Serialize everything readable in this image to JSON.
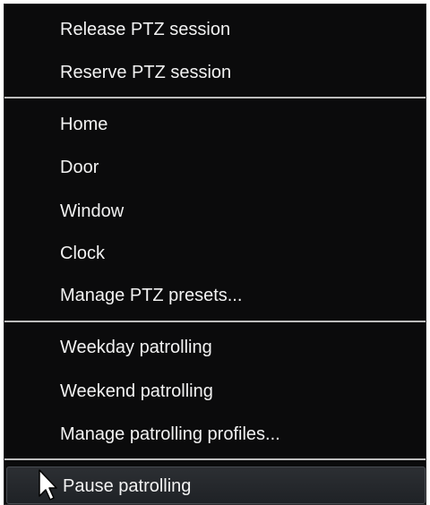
{
  "context_menu": {
    "session_group": [
      {
        "label": "Release PTZ session"
      },
      {
        "label": "Reserve PTZ session"
      }
    ],
    "preset_group": [
      {
        "label": "Home"
      },
      {
        "label": "Door"
      },
      {
        "label": "Window"
      },
      {
        "label": "Clock"
      },
      {
        "label": "Manage PTZ presets..."
      }
    ],
    "patrolling_group": [
      {
        "label": "Weekday patrolling"
      },
      {
        "label": "Weekend patrolling"
      },
      {
        "label": "Manage patrolling profiles..."
      }
    ],
    "pause_item": {
      "label": "Pause patrolling"
    },
    "cursor_icon": "arrow-pointer-icon",
    "colors": {
      "background": "#0b0b0c",
      "text": "#f2f2f2",
      "separator": "#bdbdbd",
      "highlight": "#2c2f33"
    }
  }
}
